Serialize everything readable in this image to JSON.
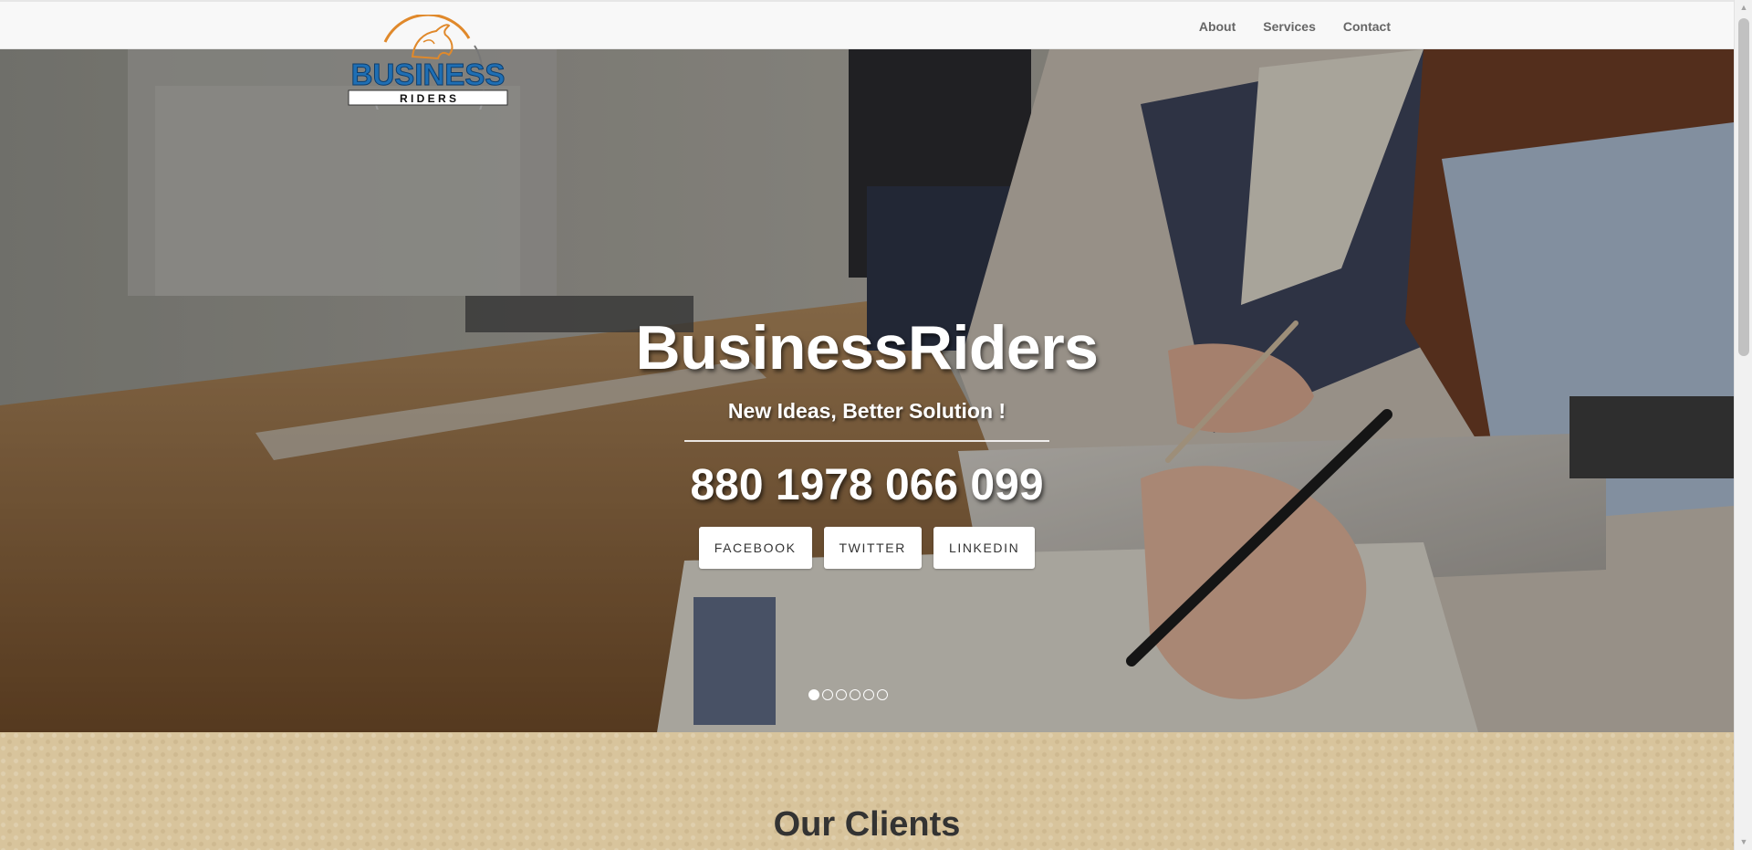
{
  "nav": {
    "links": [
      "About",
      "Services",
      "Contact"
    ]
  },
  "logo": {
    "top_text": "BUSINESS",
    "bottom_text": "R I D E R S"
  },
  "hero": {
    "title": "BusinessRiders",
    "tagline": "New Ideas, Better Solution !",
    "phone": "880 1978 066 099",
    "social_buttons": [
      "FACEBOOK",
      "TWITTER",
      "LINKEDIN"
    ],
    "slide_count": 6,
    "active_slide": 1
  },
  "clients": {
    "title": "Our Clients"
  },
  "colors": {
    "nav_bg": "#f8f8f8",
    "clients_bg": "#d8c49c",
    "logo_blue": "#1f6fb4",
    "logo_orange": "#e0892b"
  },
  "icons": {
    "scroll_up": "scroll-up-arrow",
    "scroll_down": "scroll-down-arrow",
    "logo_mark": "horse-head-icon"
  }
}
